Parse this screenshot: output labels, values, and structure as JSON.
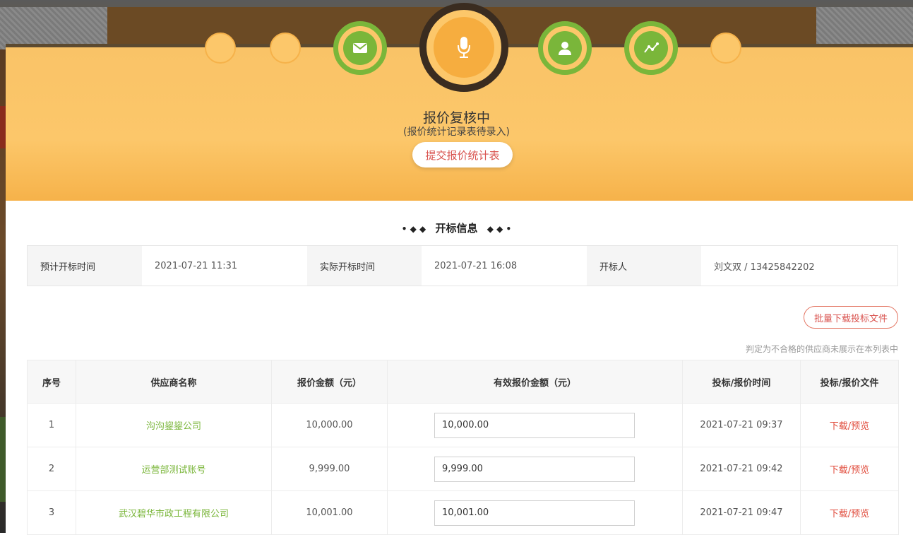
{
  "status": {
    "title": "报价复核中",
    "subtitle": "(报价统计记录表待录入)",
    "submit_label": "提交报价统计表"
  },
  "steps": [
    {
      "icon": "empty",
      "state": "done"
    },
    {
      "icon": "empty",
      "state": "done"
    },
    {
      "icon": "envelope-icon",
      "state": "done"
    },
    {
      "icon": "microphone-icon",
      "state": "current"
    },
    {
      "icon": "person-icon",
      "state": "done"
    },
    {
      "icon": "chart-line-icon",
      "state": "done"
    },
    {
      "icon": "empty",
      "state": "pending"
    }
  ],
  "section": {
    "title": "开标信息",
    "left_dots": "• ◆ ◆",
    "right_dots": "◆ ◆ •"
  },
  "info": {
    "planned_label": "预计开标时间",
    "planned_value": "2021-07-21 11:31",
    "actual_label": "实际开标时间",
    "actual_value": "2021-07-21 16:08",
    "opener_label": "开标人",
    "opener_value": "刘文双 / 13425842202"
  },
  "batch_download_label": "批量下载投标文件",
  "note": "判定为不合格的供应商未展示在本列表中",
  "table": {
    "headers": [
      "序号",
      "供应商名称",
      "报价金额（元）",
      "有效报价金额（元）",
      "投标/报价时间",
      "投标/报价文件"
    ],
    "rows": [
      {
        "no": "1",
        "supplier": "沟沟鋆鋆公司",
        "amount": "10,000.00",
        "valid_amount": "10,000.00",
        "time": "2021-07-21 09:37",
        "file": "下载/预览"
      },
      {
        "no": "2",
        "supplier": "运营部测试账号",
        "amount": "9,999.00",
        "valid_amount": "9,999.00",
        "time": "2021-07-21 09:42",
        "file": "下载/预览"
      },
      {
        "no": "3",
        "supplier": "武汉碧华市政工程有限公司",
        "amount": "10,001.00",
        "valid_amount": "10,001.00",
        "time": "2021-07-21 09:47",
        "file": "下载/预览"
      }
    ]
  },
  "colors": {
    "banner": "#fcc76a",
    "green": "#7ab63a",
    "red": "#d9534f",
    "dark_ring": "#3a2c20"
  }
}
